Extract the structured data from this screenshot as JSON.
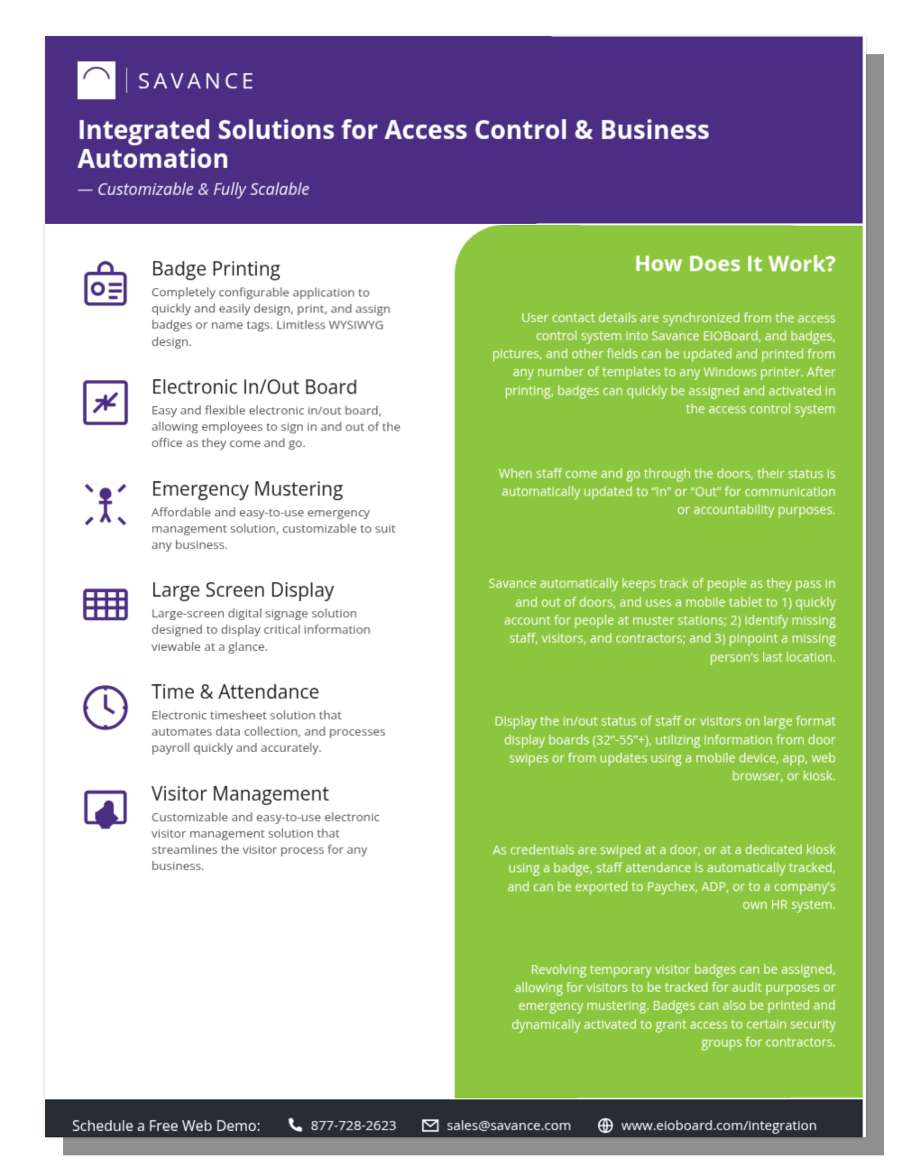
{
  "brand": {
    "name": "SAVANCE"
  },
  "header": {
    "title": "Integrated Solutions for Access Control & Business Automation",
    "subtitle": "Customizable & Fully Scalable"
  },
  "features": [
    {
      "icon": "badge-icon",
      "title": "Badge Printing",
      "desc": "Completely configurable application to quickly and easily design, print, and assign badges or name tags. Limitless WYSIWYG design."
    },
    {
      "icon": "arrows-swap-icon",
      "title": "Electronic In/Out Board",
      "desc": "Easy and flexible electronic in/out board, allowing employees to sign in and out of the office as they come and go."
    },
    {
      "icon": "muster-icon",
      "title": "Emergency Mustering",
      "desc": "Affordable and easy-to-use emergency management solution, customizable to suit any business."
    },
    {
      "icon": "grid-screen-icon",
      "title": "Large Screen Display",
      "desc": "Large-screen digital signage solution designed to display critical information viewable at a glance."
    },
    {
      "icon": "clock-icon",
      "title": "Time & Attendance",
      "desc": "Electronic timesheet solution that automates data collection, and processes payroll quickly and accurately."
    },
    {
      "icon": "touch-screen-icon",
      "title": "Visitor Management",
      "desc": "Customizable and easy-to-use electronic visitor management solution that streamlines the visitor process for any business."
    }
  ],
  "how": {
    "title": "How Does It Work?",
    "blocks": [
      "User contact details are synchronized from the access control system into Savance EIOBoard, and badges, pictures, and other fields can be updated and printed from any number of templates to any Windows printer. After printing, badges can quickly be assigned and activated in the access control system",
      "When staff come and go through the doors, their status is automatically updated to “In” or “Out” for communication or accountability purposes.",
      "Savance automatically keeps track of people as they pass in and out of doors, and uses a mobile tablet to 1) quickly account for people at muster stations; 2) identify missing staff, visitors, and contractors; and 3) pinpoint a missing person’s last location.",
      "Display the in/out status of staff or visitors on large format display boards (32”-55”+), utilizing information from door swipes or from updates using a mobile device, app, web browser, or kiosk.",
      "As credentials are swiped at a door, or at a dedicated kiosk using a badge, staff attendance is automatically tracked, and can be exported to Paychex, ADP, or to a company’s own HR system.",
      "Revolving temporary visitor badges can be assigned, allowing for visitors to be tracked for audit purposes or emergency mustering. Badges can also be printed and dynamically activated to grant access to certain security groups for contractors."
    ]
  },
  "footer": {
    "cta": "Schedule a Free Web Demo:",
    "phone": "877-728-2623",
    "email": "sales@savance.com",
    "web": "www.eioboard.com/integration"
  }
}
